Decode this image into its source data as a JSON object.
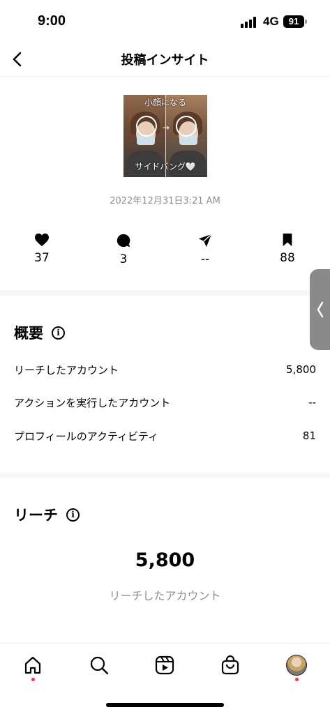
{
  "status_bar": {
    "time": "9:00",
    "network": "4G",
    "battery": "91"
  },
  "header": {
    "title": "投稿インサイト"
  },
  "post": {
    "caption_top": "小顔になる",
    "caption_bottom": "サイドバング🤍",
    "date": "2022年12月31日3:21 AM"
  },
  "stats": {
    "likes": "37",
    "comments": "3",
    "shares": "--",
    "saves": "88"
  },
  "overview": {
    "title": "概要",
    "rows": [
      {
        "label": "リーチしたアカウント",
        "value": "5,800"
      },
      {
        "label": "アクションを実行したアカウント",
        "value": "--"
      },
      {
        "label": "プロフィールのアクティビティ",
        "value": "81"
      }
    ]
  },
  "reach": {
    "title": "リーチ",
    "value": "5,800",
    "label": "リーチしたアカウント"
  },
  "tab_bar": {
    "items": [
      "home-icon",
      "search-icon",
      "reels-icon",
      "shop-icon",
      "profile-avatar"
    ],
    "notification_color": "#ff3040"
  }
}
